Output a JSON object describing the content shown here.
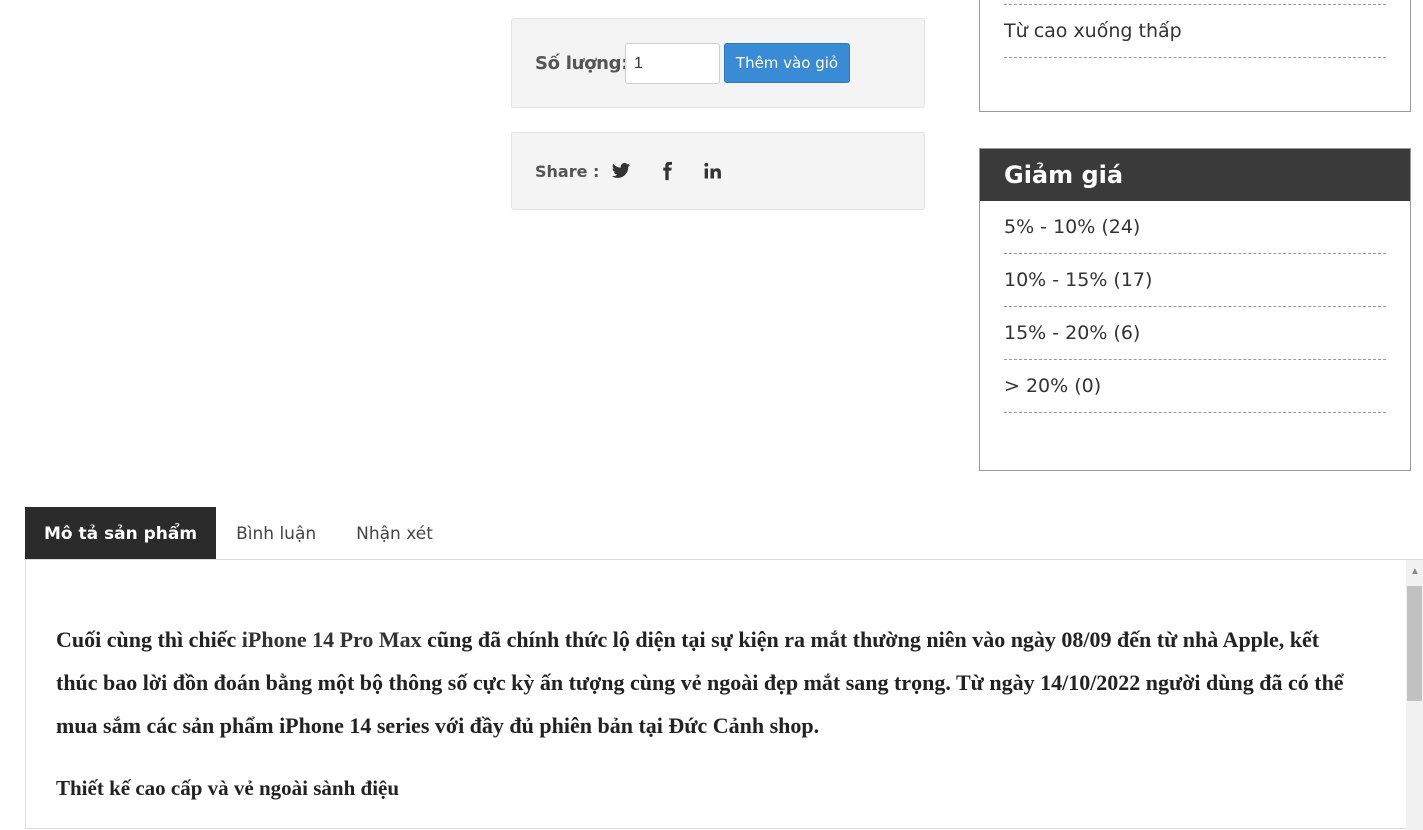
{
  "purchase": {
    "quantity_label": "Số lượng:",
    "quantity_value": "1",
    "add_to_cart_label": "Thêm vào giỏ"
  },
  "share": {
    "label": "Share :",
    "icons": [
      "twitter-icon",
      "facebook-icon",
      "linkedin-icon"
    ]
  },
  "sort_panel": {
    "items": [
      "Từ cao xuống thấp"
    ]
  },
  "discount_panel": {
    "title": "Giảm giá",
    "items": [
      "5% - 10% (24)",
      "10% - 15% (17)",
      "15% - 20% (6)",
      "> 20% (0)"
    ]
  },
  "tabs": [
    {
      "label": "Mô tả sản phẩm",
      "active": true
    },
    {
      "label": "Bình luận",
      "active": false
    },
    {
      "label": "Nhận xét",
      "active": false
    }
  ],
  "description": {
    "intro_before": "Cuối cùng thì chiếc ",
    "product_name": "iPhone 14 Pro Max",
    "intro_after": " cũng đã chính thức lộ diện tại sự kiện ra mắt thường niên vào ngày 08/09 đến từ nhà Apple, kết thúc bao lời đồn đoán bằng một bộ thông số cực kỳ ấn tượng cùng vẻ ngoài đẹp mắt sang trọng. Từ ngày 14/10/2022 người dùng đã có thể mua sắm các sản phẩm iPhone 14 series với đầy đủ phiên bản tại Đức Cảnh shop.",
    "subheading": "Thiết kế cao cấp và vẻ ngoài sành điệu"
  },
  "colors": {
    "button_blue": "#3a8bd6",
    "panel_header": "#3a3a3a",
    "active_tab": "#2b2b2b"
  }
}
